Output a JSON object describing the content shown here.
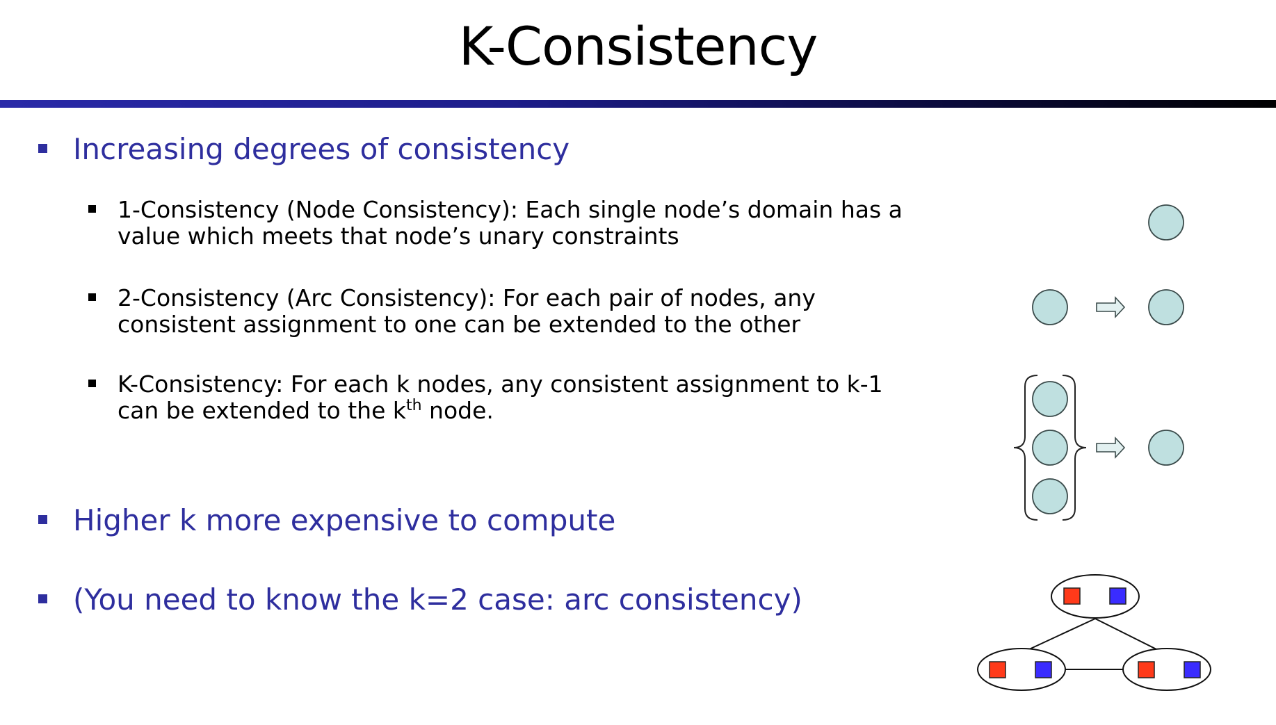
{
  "slide": {
    "title": "K-Consistency"
  },
  "bullets": [
    {
      "text": "Increasing degrees of consistency"
    },
    {
      "text": "Higher k more expensive to compute"
    },
    {
      "text": "(You need to know the k=2 case: arc consistency)"
    }
  ],
  "sub_bullets": [
    {
      "line1": "1-Consistency (Node Consistency): Each single node’s domain has a",
      "line2": "value which meets that node’s unary constraints"
    },
    {
      "line1": "2-Consistency (Arc Consistency): For each pair of nodes, any",
      "line2": "consistent assignment to one can be extended to the other"
    },
    {
      "line1": "K-Consistency: For each k nodes, any consistent assignment to k-1",
      "line2_pre": "can be extended to the k",
      "line2_sup": "th",
      "line2_post": " node."
    }
  ],
  "colors": {
    "bullet_text": "#2e2e9e",
    "node_fill": "#bfe0e0",
    "value_red": "#ff3a1a",
    "value_blue": "#3a2cff"
  }
}
